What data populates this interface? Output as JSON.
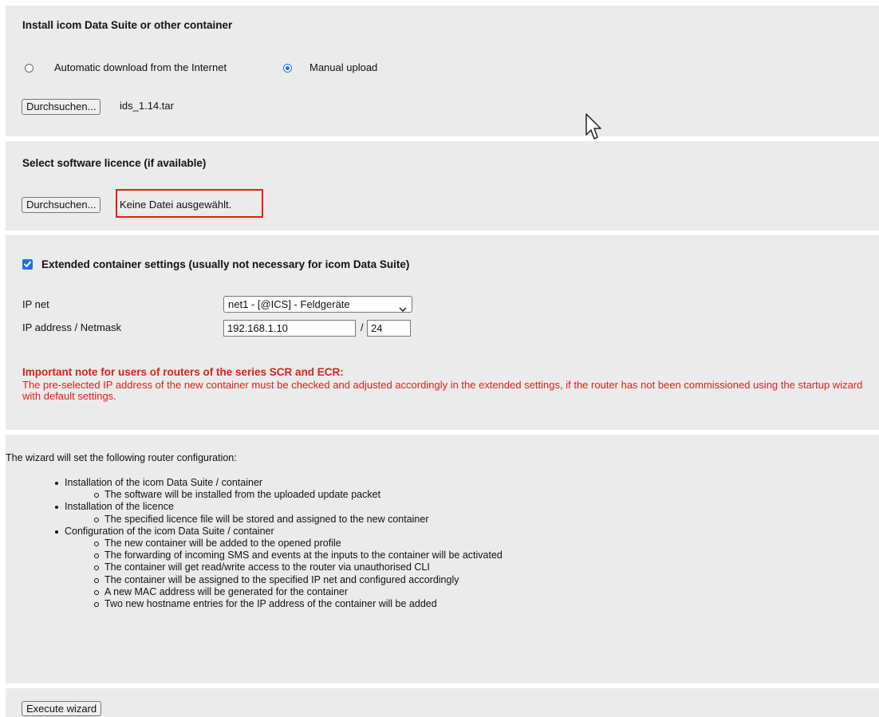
{
  "install": {
    "title": "Install icom Data Suite or other container",
    "radio_auto_label": "Automatic download from the Internet",
    "radio_manual_label": "Manual upload",
    "browse_label": "Durchsuchen...",
    "file_name": "ids_1.14.tar"
  },
  "licence": {
    "title": "Select software licence (if available)",
    "browse_label": "Durchsuchen...",
    "file_status": "Keine Datei ausgewählt."
  },
  "extended": {
    "checkbox_label": "Extended container settings (usually not necessary for icom Data Suite)",
    "ip_net_label": "IP net",
    "ip_net_value": "net1 - [@ICS] - Feldgeräte",
    "ip_address_label": "IP address / Netmask",
    "ip_address_value": "192.168.1.10",
    "slash": "/",
    "netmask_value": "24",
    "warning_title": "Important note for users of routers of the series SCR and ECR:",
    "warning_text": "The pre-selected IP address of the new container must be checked and adjusted accordingly in the extended settings, if the router has not been commissioned using the startup wizard with default settings."
  },
  "summary": {
    "intro": "The wizard will set the following router configuration:",
    "items": [
      {
        "label": "Installation of the icom Data Suite / container",
        "sub": [
          "The software will be installed from the uploaded update packet"
        ]
      },
      {
        "label": "Installation of the licence",
        "sub": [
          "The specified licence file will be stored and assigned to the new container"
        ]
      },
      {
        "label": "Configuration of the icom Data Suite / container",
        "sub": [
          "The new container will be added to the opened profile",
          "The forwarding of incoming SMS and events at the inputs to the container will be activated",
          "The container will get read/write access to the router via unauthorised CLI",
          "The container will be assigned to the specified IP net and configured accordingly",
          "A new MAC address will be generated for the container",
          "Two new hostname entries for the IP address of the container will be added"
        ]
      }
    ]
  },
  "execute": {
    "button_label": "Execute wizard"
  },
  "colors": {
    "panel_bg": "#ebebeb",
    "warning": "#e0201b",
    "accent": "#1a73e8"
  },
  "icons": {
    "cursor": "mouse-pointer-icon",
    "select_chevron": "chevron-down-icon",
    "checkbox_check": "check-icon"
  }
}
